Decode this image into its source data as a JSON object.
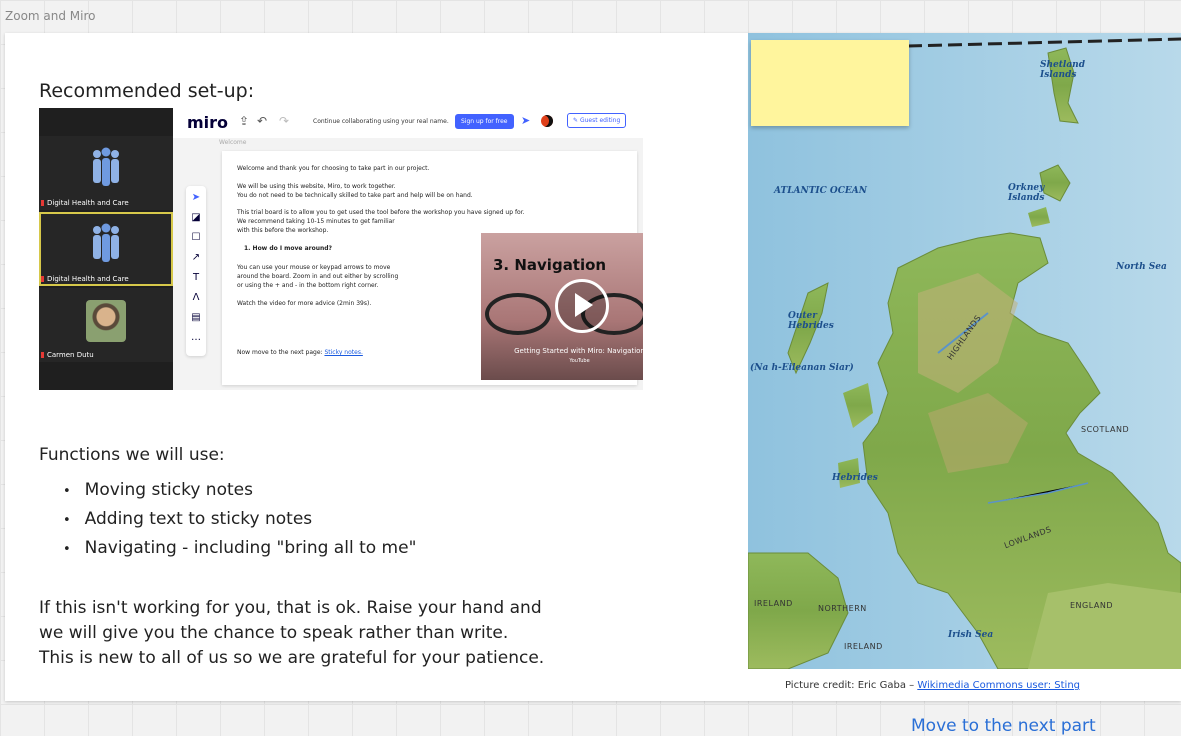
{
  "board": {
    "title": "Zoom and Miro"
  },
  "setup": {
    "heading": "Recommended set-up:"
  },
  "zoom_panel": {
    "participants": [
      {
        "name": "Digital Health and Care"
      },
      {
        "name": "Digital Health and Care"
      },
      {
        "name": "Carmen Dutu"
      }
    ]
  },
  "miro": {
    "logo": "miro",
    "collab_text": "Continue collaborating using your real name.",
    "signup_label": "Sign up for free",
    "guest_label": "Guest editing",
    "frame_label": "Welcome",
    "doc": {
      "line1": "Welcome and thank you for choosing to take part in our project.",
      "line2": "We will be using this website, Miro, to work together.",
      "line3": "You do not need to be technically skilled to take part and help will be on hand.",
      "line4": "This trial board is to allow you to get used the tool before the workshop you have signed up for.",
      "line5": "We recommend taking 10-15 minutes to get familiar",
      "line6": "with this before the workshop.",
      "q1": "1. How do I move around?",
      "line7": "You can use your mouse or keypad arrows to move",
      "line8": "around the board. Zoom in and out either by scrolling",
      "line9": "or using the + and - in the bottom right corner.",
      "line10": "Watch the video for more advice (2min 39s).",
      "next_prefix": "Now move to the next page:",
      "next_link": "Sticky notes."
    },
    "video": {
      "title": "3. Navigation",
      "caption": "Getting Started with Miro: Navigation",
      "source": "YouTube"
    }
  },
  "functions": {
    "heading": "Functions we will use:",
    "items": [
      "Moving sticky notes",
      "Adding text to sticky notes",
      "Navigating - including \"bring all to me\""
    ]
  },
  "note": {
    "line1": "If this isn't working for you, that is ok. Raise your hand and",
    "line2": "we will give you the chance to speak rather than write.",
    "line3": "This is new to all of us so we are grateful for your patience."
  },
  "map": {
    "labels": {
      "atlantic": "ATLANTIC OCEAN",
      "north_sea": "North Sea",
      "scotland": "SCOTLAND",
      "shetland": "Shetland Islands",
      "orkney": "Orkney Islands",
      "outer_hebrides": "Outer Hebrides",
      "na_h": "(Na h-Eileanan Siar)",
      "hebrides": "Hebrides",
      "highlands": "HIGHLANDS",
      "lowlands": "LOWLANDS",
      "ireland": "IRELAND",
      "northern": "NORTHERN",
      "ireland2": "IRELAND",
      "england": "ENGLAND",
      "irish_sea": "Irish Sea"
    },
    "colors": {
      "sea": "#9ccbe4",
      "land_low": "#7fae4f",
      "land_high": "#c9b27a"
    }
  },
  "credit": {
    "prefix": "Picture credit: Eric Gaba –",
    "link": "Wikimedia Commons user: Sting"
  },
  "nav": {
    "next_label": "Move to the next part"
  }
}
